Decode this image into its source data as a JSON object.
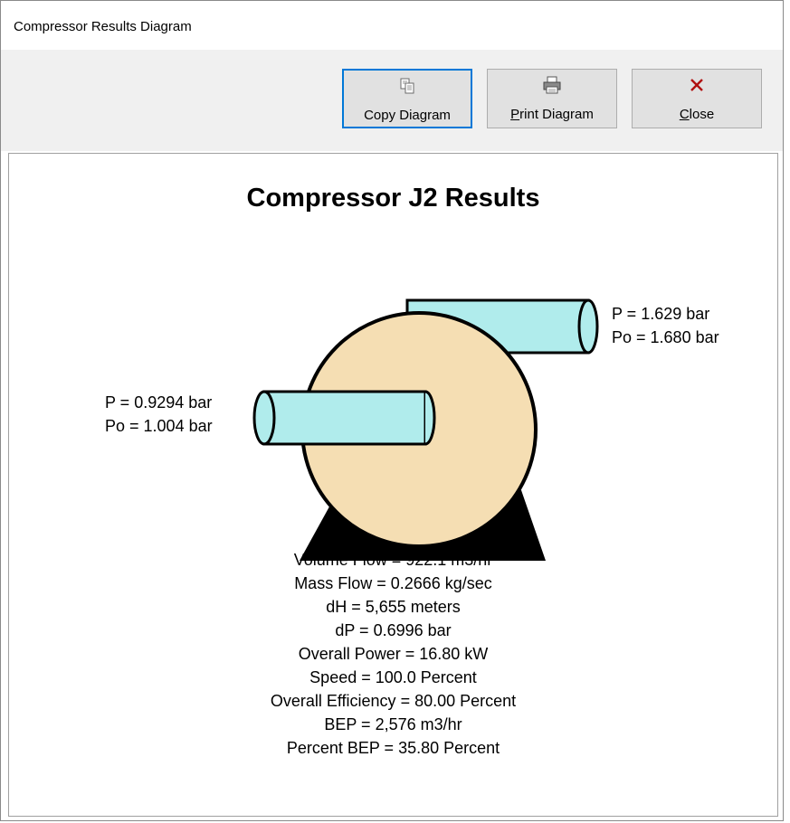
{
  "window": {
    "title": "Compressor Results Diagram"
  },
  "toolbar": {
    "buttons": [
      {
        "icon": "copy-icon",
        "label_pre": "",
        "label_u": "",
        "label_post": "Copy Diagram"
      },
      {
        "icon": "printer-icon",
        "label_pre": "",
        "label_u": "P",
        "label_post": "rint Diagram"
      },
      {
        "icon": "close-x-icon",
        "label_pre": "",
        "label_u": "C",
        "label_post": "lose"
      }
    ]
  },
  "diagram": {
    "title": "Compressor J2 Results",
    "inlet": {
      "p": "P = 0.9294 bar",
      "po": "Po = 1.004 bar"
    },
    "outlet": {
      "p": "P = 1.629 bar",
      "po": "Po = 1.680 bar"
    },
    "results": [
      "Volume Flow = 922.1 m3/hr",
      "Mass Flow = 0.2666 kg/sec",
      "dH = 5,655 meters",
      "dP = 0.6996 bar",
      "Overall Power = 16.80 kW",
      "Speed = 100.0 Percent",
      "Overall Efficiency = 80.00 Percent",
      "BEP = 2,576 m3/hr",
      "Percent BEP = 35.80 Percent"
    ],
    "colors": {
      "body": "#f5deb3",
      "pipe": "#b0ecec",
      "base": "#000000",
      "close_icon": "#b01010",
      "focus": "#0078d7"
    }
  }
}
